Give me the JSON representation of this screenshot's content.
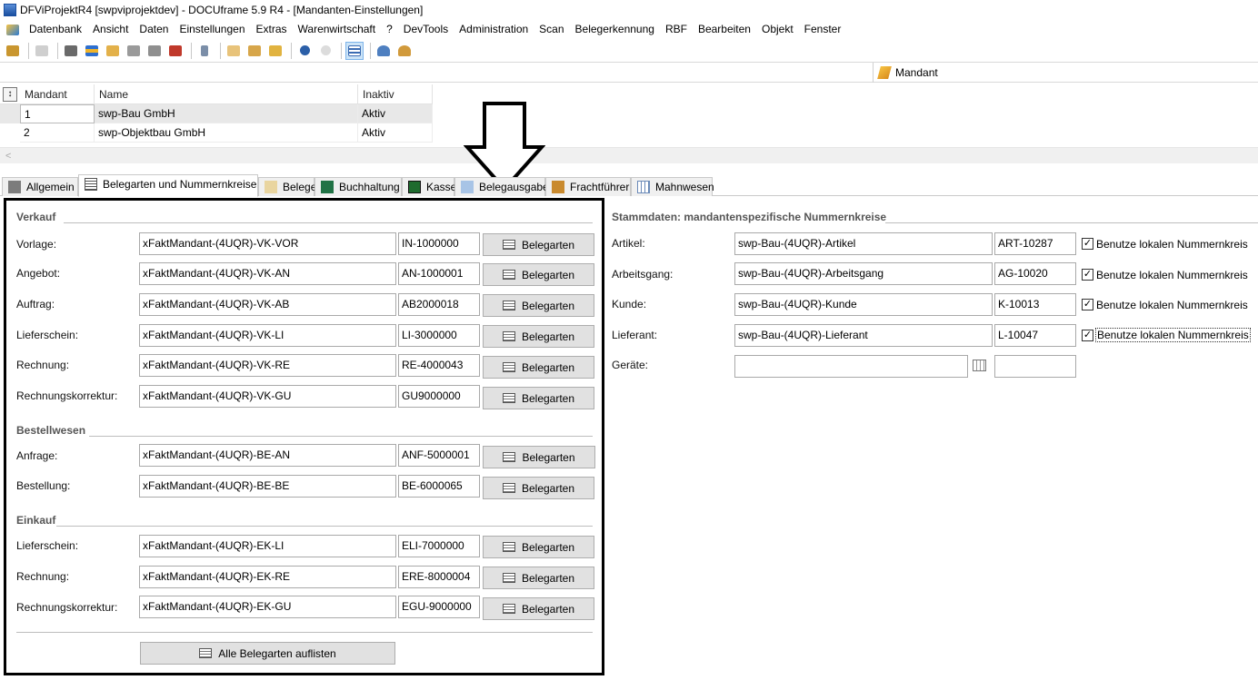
{
  "window": {
    "title": "DFViProjektR4 [swpviprojektdev] - DOCUframe 5.9 R4 - [Mandanten-Einstellungen]"
  },
  "menu": [
    "Datenbank",
    "Ansicht",
    "Daten",
    "Einstellungen",
    "Extras",
    "Warenwirtschaft",
    "?",
    "DevTools",
    "Administration",
    "Scan",
    "Belegerkennung",
    "RBF",
    "Bearbeiten",
    "Objekt",
    "Fenster"
  ],
  "panel": {
    "tab_label": "Mandant"
  },
  "grid": {
    "headers": [
      "Mandant",
      "Name",
      "Inaktiv"
    ],
    "rows": [
      [
        "1",
        "swp-Bau GmbH",
        "Aktiv"
      ],
      [
        "2",
        "swp-Objektbau GmbH",
        "Aktiv"
      ]
    ]
  },
  "scroll": {
    "left_arrow": "<"
  },
  "tabs": [
    "Allgemein",
    "Belegarten und Nummernkreise",
    "Belege",
    "Buchhaltung",
    "Kasse",
    "Belegausgabe",
    "Frachtführer",
    "Mahnwesen"
  ],
  "left": {
    "sections": {
      "verkauf": "Verkauf",
      "bestellwesen": "Bestellwesen",
      "einkauf": "Einkauf"
    },
    "button_label": "Belegarten",
    "verkauf_rows": [
      {
        "label": "Vorlage:",
        "value": "xFaktMandant-(4UQR)-VK-VOR",
        "number": "IN-1000000"
      },
      {
        "label": "Angebot:",
        "value": "xFaktMandant-(4UQR)-VK-AN",
        "number": "AN-1000001"
      },
      {
        "label": "Auftrag:",
        "value": "xFaktMandant-(4UQR)-VK-AB",
        "number": "AB2000018"
      },
      {
        "label": "Lieferschein:",
        "value": "xFaktMandant-(4UQR)-VK-LI",
        "number": "LI-3000000"
      },
      {
        "label": "Rechnung:",
        "value": "xFaktMandant-(4UQR)-VK-RE",
        "number": "RE-4000043"
      },
      {
        "label": "Rechnungskorrektur:",
        "value": "xFaktMandant-(4UQR)-VK-GU",
        "number": "GU9000000"
      }
    ],
    "bestell_rows": [
      {
        "label": "Anfrage:",
        "value": "xFaktMandant-(4UQR)-BE-AN",
        "number": "ANF-5000001"
      },
      {
        "label": "Bestellung:",
        "value": "xFaktMandant-(4UQR)-BE-BE",
        "number": "BE-6000065"
      }
    ],
    "einkauf_rows": [
      {
        "label": "Lieferschein:",
        "value": "xFaktMandant-(4UQR)-EK-LI",
        "number": "ELI-7000000"
      },
      {
        "label": "Rechnung:",
        "value": "xFaktMandant-(4UQR)-EK-RE",
        "number": "ERE-8000004"
      },
      {
        "label": "Rechnungskorrektur:",
        "value": "xFaktMandant-(4UQR)-EK-GU",
        "number": "EGU-9000000"
      }
    ],
    "list_all_button": "Alle Belegarten auflisten"
  },
  "right": {
    "title": "Stammdaten: mandantenspezifische Nummernkreise",
    "checkbox_label": "Benutze lokalen Nummernkreis",
    "rows": [
      {
        "label": "Artikel:",
        "value": "swp-Bau-(4UQR)-Artikel",
        "number": "ART-10287",
        "checked": "✓"
      },
      {
        "label": "Arbeitsgang:",
        "value": "swp-Bau-(4UQR)-Arbeitsgang",
        "number": "AG-10020",
        "checked": "✓"
      },
      {
        "label": "Kunde:",
        "value": "swp-Bau-(4UQR)-Kunde",
        "number": "K-10013",
        "checked": "✓"
      },
      {
        "label": "Lieferant:",
        "value": "swp-Bau-(4UQR)-Lieferant",
        "number": "L-10047",
        "checked": "✓"
      }
    ],
    "geraete_label": "Geräte:"
  }
}
